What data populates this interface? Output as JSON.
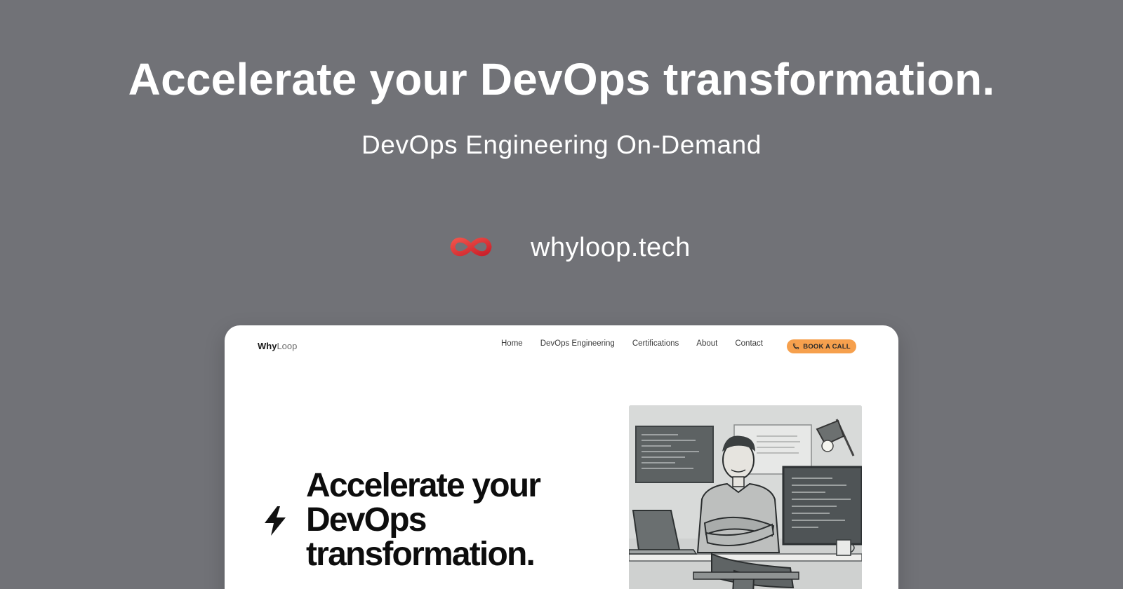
{
  "hero": {
    "title": "Accelerate your DevOps transformation.",
    "subtitle": "DevOps Engineering On-Demand",
    "url": "whyloop.tech",
    "logo_icon": "infinity-loop-icon",
    "logo_color": "#e8403a"
  },
  "site": {
    "logo_bold": "Why",
    "logo_light": "Loop",
    "nav": [
      "Home",
      "DevOps Engineering",
      "Certifications",
      "About",
      "Contact"
    ],
    "cta_label": "BOOK A CALL",
    "cta_icon": "phone-icon",
    "cta_color": "#f6a04d",
    "headline": [
      "Accelerate your",
      "DevOps",
      "transformation."
    ],
    "headline_icon": "lightning-bolt-icon",
    "hero_image": "illustration-developer-at-desk"
  }
}
